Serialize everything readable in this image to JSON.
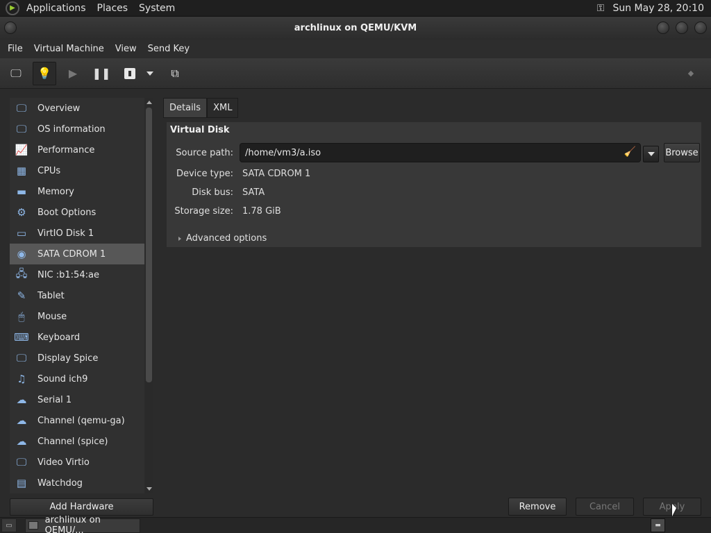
{
  "top_panel": {
    "menus": [
      "Applications",
      "Places",
      "System"
    ],
    "clock": "Sun May 28, 20:10"
  },
  "window": {
    "title": "archlinux on QEMU/KVM"
  },
  "menubar": [
    "File",
    "Virtual Machine",
    "View",
    "Send Key"
  ],
  "toolbar": {
    "buttons": [
      "console-button",
      "details-button",
      "run-button",
      "pause-button",
      "shutdown-button",
      "shutdown-menu-button",
      "snapshots-button",
      "fullscreen-button"
    ]
  },
  "sidebar": {
    "selected_index": 7,
    "items": [
      {
        "label": "Overview",
        "icon": "monitor-icon"
      },
      {
        "label": "OS information",
        "icon": "monitor-icon"
      },
      {
        "label": "Performance",
        "icon": "performance-graph-icon"
      },
      {
        "label": "CPUs",
        "icon": "cpu-chip-icon"
      },
      {
        "label": "Memory",
        "icon": "memory-stick-icon"
      },
      {
        "label": "Boot Options",
        "icon": "gears-icon"
      },
      {
        "label": "VirtIO Disk 1",
        "icon": "hard-disk-icon"
      },
      {
        "label": "SATA CDROM 1",
        "icon": "cdrom-icon"
      },
      {
        "label": "NIC :b1:54:ae",
        "icon": "network-icon"
      },
      {
        "label": "Tablet",
        "icon": "tablet-icon"
      },
      {
        "label": "Mouse",
        "icon": "mouse-icon"
      },
      {
        "label": "Keyboard",
        "icon": "keyboard-icon"
      },
      {
        "label": "Display Spice",
        "icon": "display-icon"
      },
      {
        "label": "Sound ich9",
        "icon": "sound-icon"
      },
      {
        "label": "Serial 1",
        "icon": "serial-icon"
      },
      {
        "label": "Channel (qemu-ga)",
        "icon": "channel-icon"
      },
      {
        "label": "Channel (spice)",
        "icon": "channel-icon"
      },
      {
        "label": "Video Virtio",
        "icon": "video-icon"
      },
      {
        "label": "Watchdog",
        "icon": "watchdog-icon"
      }
    ],
    "add_hardware": "Add Hardware"
  },
  "tabs": [
    {
      "label": "Details",
      "active": true
    },
    {
      "label": "XML",
      "active": false
    }
  ],
  "details": {
    "section_title": "Virtual Disk",
    "source_path_label": "Source path:",
    "source_path_value": "/home/vm3/a.iso",
    "browse_label": "Browse",
    "device_type_label": "Device type:",
    "device_type_value": "SATA CDROM 1",
    "disk_bus_label": "Disk bus:",
    "disk_bus_value": "SATA",
    "storage_size_label": "Storage size:",
    "storage_size_value": "1.78 GiB",
    "advanced_label": "Advanced options"
  },
  "actions": {
    "remove": "Remove",
    "cancel": "Cancel",
    "apply": "Apply"
  },
  "taskbar": {
    "task_label": "archlinux on QEMU/..."
  },
  "colors": {
    "background": "#2b2b2b",
    "selected_row": "#575757",
    "panel": "#383838"
  }
}
